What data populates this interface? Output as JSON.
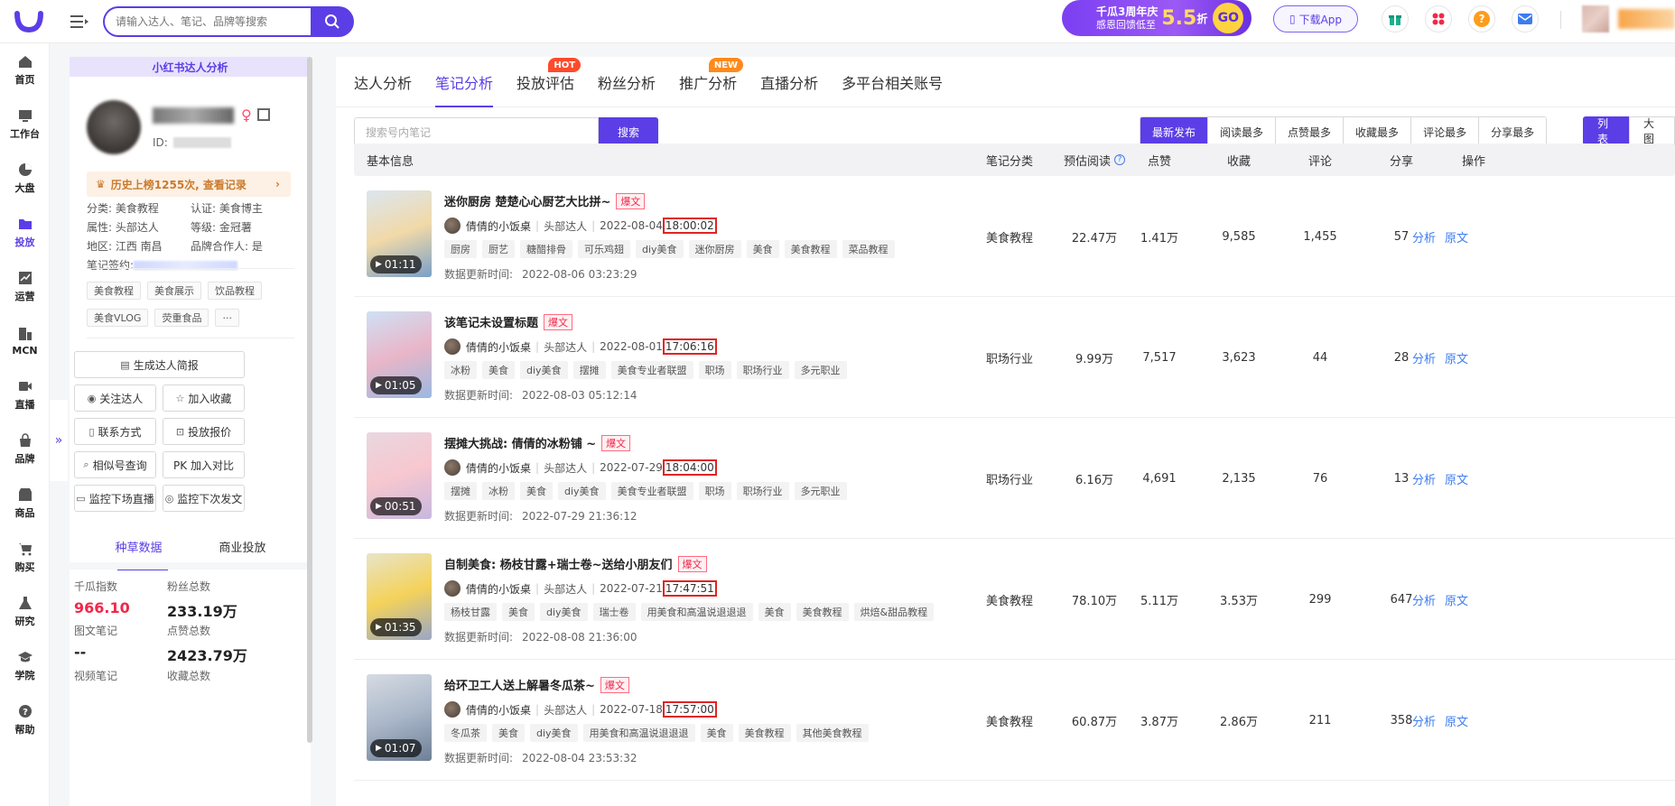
{
  "header": {
    "search_placeholder": "请输入达人、笔记、品牌等搜索",
    "banner_line1": "千瓜3周年庆",
    "banner_line2": "感恩回馈低至",
    "banner_num": "5.5",
    "banner_unit": "折",
    "banner_go": "GO",
    "download_label": "下载App"
  },
  "nav": {
    "items": [
      {
        "label": "首页",
        "icon": "home-icon"
      },
      {
        "label": "工作台",
        "icon": "workbench-icon"
      },
      {
        "label": "大盘",
        "icon": "pie-chart-icon"
      },
      {
        "label": "投放",
        "icon": "folder-icon"
      },
      {
        "label": "运营",
        "icon": "trend-icon"
      },
      {
        "label": "MCN",
        "icon": "mcn-icon"
      },
      {
        "label": "直播",
        "icon": "video-icon"
      },
      {
        "label": "品牌",
        "icon": "bag-icon"
      },
      {
        "label": "商品",
        "icon": "shop-icon"
      },
      {
        "label": "购买",
        "icon": "cart-icon"
      },
      {
        "label": "研究",
        "icon": "flask-icon"
      },
      {
        "label": "学院",
        "icon": "graduation-icon"
      },
      {
        "label": "帮助",
        "icon": "help-icon"
      }
    ],
    "collapse": "»"
  },
  "profile": {
    "header": "小红书达人分析",
    "id_label": "ID:",
    "gender": "♀",
    "history": "历史上榜1255次, 查看记录",
    "info": {
      "category": "分类: 美食教程",
      "certify": "认证: 美食博主",
      "attr": "属性: 头部达人",
      "level": "等级: 金冠薯",
      "region": "地区: 江西 南昌",
      "brand_partner": "品牌合作人: 是",
      "signature": "笔记签约: "
    },
    "tags": [
      "美食教程",
      "美食展示",
      "饮品教程",
      "美食VLOG",
      "荧重食品",
      "···"
    ],
    "buttons": {
      "report": "生成达人简报",
      "follow": "关注达人",
      "favorite": "加入收藏",
      "contact": "联系方式",
      "quote": "投放报价",
      "similar": "相似号查询",
      "pk": "PK 加入对比",
      "monitor_live": "监控下场直播",
      "monitor_post": "监控下次发文"
    },
    "subtabs": [
      "种草数据",
      "商业投放"
    ],
    "stats": {
      "qiangua_label": "千瓜指数",
      "qiangua_value": "966.10",
      "fans_label": "粉丝总数",
      "fans_value": "233.19万",
      "img_notes_label": "图文笔记",
      "img_notes_value": "--",
      "likes_label": "点赞总数",
      "likes_value": "2423.79万",
      "video_notes_label": "视频笔记",
      "collect_label": "收藏总数"
    }
  },
  "main": {
    "tabs": [
      {
        "label": "达人分析",
        "badge": ""
      },
      {
        "label": "笔记分析",
        "badge": ""
      },
      {
        "label": "投放评估",
        "badge": "HOT"
      },
      {
        "label": "粉丝分析",
        "badge": ""
      },
      {
        "label": "推广分析",
        "badge": "NEW"
      },
      {
        "label": "直播分析",
        "badge": ""
      },
      {
        "label": "多平台相关账号",
        "badge": ""
      }
    ],
    "note_search_placeholder": "搜索号内笔记",
    "note_search_btn": "搜索",
    "sorts": [
      "最新发布",
      "阅读最多",
      "点赞最多",
      "收藏最多",
      "评论最多",
      "分享最多"
    ],
    "views": [
      "列表",
      "大图"
    ],
    "columns": {
      "basic": "基本信息",
      "category": "笔记分类",
      "reads": "预估阅读",
      "likes": "点赞",
      "collects": "收藏",
      "comments": "评论",
      "shares": "分享",
      "ops": "操作"
    },
    "op_analyze": "分析",
    "op_original": "原文",
    "update_prefix": "数据更新时间:",
    "hot_label": "爆文",
    "author_name": "倩倩的小饭桌",
    "author_level": "头部达人"
  },
  "notes": [
    {
      "title": "迷你厨房 楚楚心心厨艺大比拼~",
      "date": "2022-08-04",
      "time": "18:00:02",
      "tags": [
        "厨房",
        "厨艺",
        "糖醋排骨",
        "可乐鸡翅",
        "diy美食",
        "迷你厨房",
        "美食",
        "美食教程",
        "菜品教程"
      ],
      "updated": "2022-08-06 03:23:29",
      "duration": "01:11",
      "category": "美食教程",
      "reads": "22.47万",
      "likes": "1.41万",
      "collects": "9,585",
      "comments": "1,455",
      "shares": "57"
    },
    {
      "title": "该笔记未设置标题",
      "date": "2022-08-01",
      "time": "17:06:16",
      "tags": [
        "冰粉",
        "美食",
        "diy美食",
        "摆摊",
        "美食专业者联盟",
        "职场",
        "职场行业",
        "多元职业"
      ],
      "updated": "2022-08-03 05:12:14",
      "duration": "01:05",
      "category": "职场行业",
      "reads": "9.99万",
      "likes": "7,517",
      "collects": "3,623",
      "comments": "44",
      "shares": "28"
    },
    {
      "title": "摆摊大挑战: 倩倩的冰粉铺 ~",
      "date": "2022-07-29",
      "time": "18:04:00",
      "tags": [
        "摆摊",
        "冰粉",
        "美食",
        "diy美食",
        "美食专业者联盟",
        "职场",
        "职场行业",
        "多元职业"
      ],
      "updated": "2022-07-29 21:36:12",
      "duration": "00:51",
      "category": "职场行业",
      "reads": "6.16万",
      "likes": "4,691",
      "collects": "2,135",
      "comments": "76",
      "shares": "13"
    },
    {
      "title": "自制美食: 杨枝甘露+瑞士卷~送给小朋友们",
      "date": "2022-07-21",
      "time": "17:47:51",
      "tags": [
        "杨枝甘露",
        "美食",
        "diy美食",
        "瑞士卷",
        "用美食和高温说退退退",
        "美食",
        "美食教程",
        "烘焙&甜品教程"
      ],
      "updated": "2022-08-08 21:36:00",
      "duration": "01:35",
      "category": "美食教程",
      "reads": "78.10万",
      "likes": "5.11万",
      "collects": "3.53万",
      "comments": "299",
      "shares": "647"
    },
    {
      "title": "给环卫工人送上解暑冬瓜茶~",
      "date": "2022-07-18",
      "time": "17:57:00",
      "tags": [
        "冬瓜茶",
        "美食",
        "diy美食",
        "用美食和高温说退退退",
        "美食",
        "美食教程",
        "其他美食教程"
      ],
      "updated": "2022-08-04 23:53:32",
      "duration": "01:07",
      "category": "美食教程",
      "reads": "60.87万",
      "likes": "3.87万",
      "collects": "2.86万",
      "comments": "211",
      "shares": "358"
    }
  ],
  "colors": {
    "accent": "#5b3ee6",
    "highlight_box": "#e02424",
    "qiangua_value": "#f0284a",
    "link": "#3d7cf0"
  }
}
